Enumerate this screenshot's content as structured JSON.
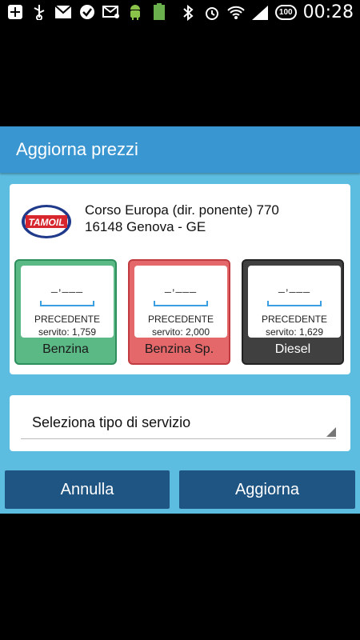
{
  "status_bar": {
    "time": "00:28",
    "battery_level": "100",
    "icons": [
      "add-icon",
      "usb-icon",
      "gmail-icon",
      "check-icon",
      "mail-icon",
      "android-icon",
      "battery-status-icon",
      "bluetooth-icon",
      "alarm-icon",
      "wifi-icon",
      "signal-icon"
    ],
    "mini_battery_label": "100%"
  },
  "dialog": {
    "title": "Aggiorna prezzi",
    "station": {
      "brand": "TAMOIL",
      "address_line1": "Corso Europa (dir. ponente) 770",
      "address_line2": "16148 Genova - GE"
    },
    "fuels": [
      {
        "price_placeholder": "_,___",
        "prev_label": "PRECEDENTE",
        "prev_value": "servito: 1,759",
        "name": "Benzina"
      },
      {
        "price_placeholder": "_,___",
        "prev_label": "PRECEDENTE",
        "prev_value": "servito: 2,000",
        "name": "Benzina Sp."
      },
      {
        "price_placeholder": "_,___",
        "prev_label": "PRECEDENTE",
        "prev_value": "servito: 1,629",
        "name": "Diesel"
      }
    ],
    "service_select": {
      "label": "Seleziona tipo di servizio"
    },
    "buttons": {
      "cancel": "Annulla",
      "confirm": "Aggiorna"
    }
  },
  "colors": {
    "dialog_bg": "#5dbde1",
    "title_bar": "#3a96d0",
    "benzina": "#5ab985",
    "benzina_sp": "#e4676a",
    "diesel": "#404040",
    "button": "#1f5582"
  }
}
